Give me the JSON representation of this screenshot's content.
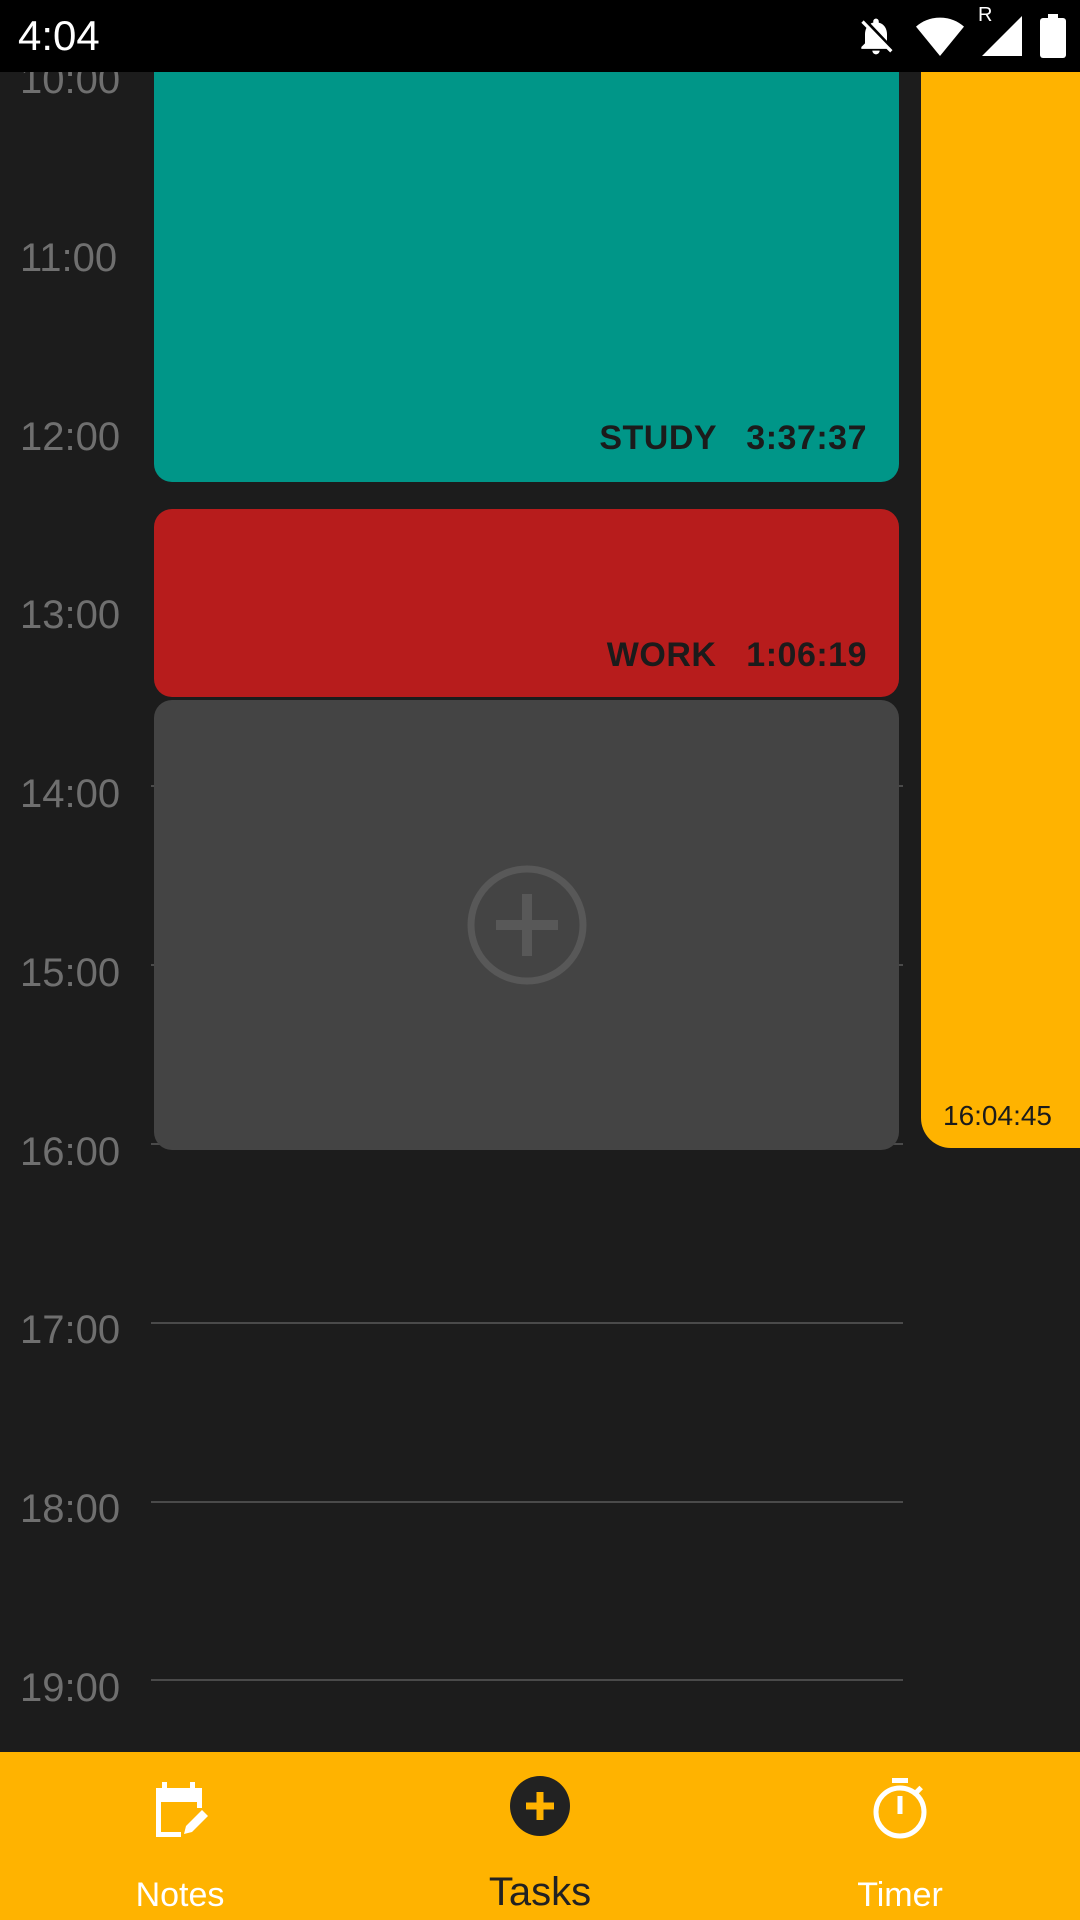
{
  "status_bar": {
    "time": "4:04",
    "icons": [
      "notifications-off-icon",
      "wifi-icon",
      "signal-icon",
      "battery-icon"
    ],
    "roaming_indicator": "R"
  },
  "timeline": {
    "hours": [
      "10:00",
      "11:00",
      "12:00",
      "13:00",
      "14:00",
      "15:00",
      "16:00",
      "17:00",
      "18:00",
      "19:00"
    ],
    "blocks": [
      {
        "name": "STUDY",
        "duration": "3:37:37",
        "color": "#009688"
      },
      {
        "name": "WORK",
        "duration": "1:06:19",
        "color": "#b71c1c"
      }
    ],
    "add_block": {
      "icon": "add-circle-icon",
      "color": "#444444"
    },
    "current_time": {
      "label": "16:04:45",
      "color": "#ffb300"
    }
  },
  "bottom_nav": {
    "items": [
      {
        "label": "Notes",
        "icon": "calendar-edit-icon",
        "active": false
      },
      {
        "label": "Tasks",
        "icon": "add-circle-filled-icon",
        "active": true
      },
      {
        "label": "Timer",
        "icon": "stopwatch-icon",
        "active": false
      }
    ],
    "background": "#ffb300"
  }
}
